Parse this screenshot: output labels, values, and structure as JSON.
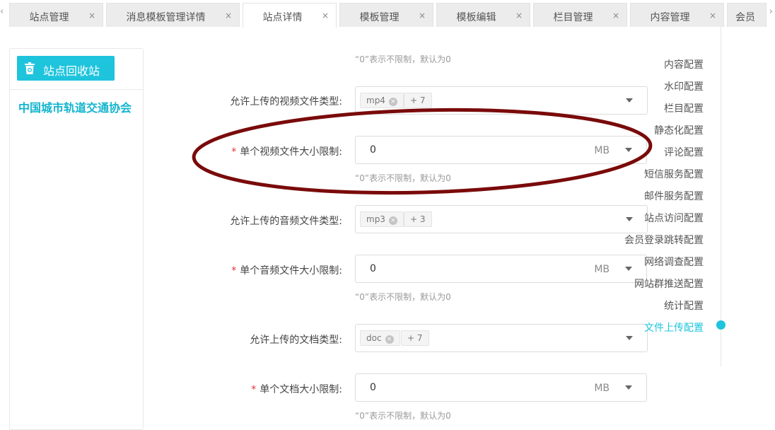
{
  "tabs": [
    {
      "label": "站点管理",
      "close": "×"
    },
    {
      "label": "消息模板管理详情",
      "close": "×"
    },
    {
      "label": "站点详情",
      "close": "×",
      "active": true
    },
    {
      "label": "模板管理",
      "close": "×"
    },
    {
      "label": "模板编辑",
      "close": "×"
    },
    {
      "label": "栏目管理",
      "close": "×"
    },
    {
      "label": "内容管理",
      "close": "×"
    },
    {
      "label": "会员",
      "close": ""
    }
  ],
  "tab_nav": {
    "prev": "‹",
    "next": "›"
  },
  "left_panel": {
    "recycle_button": "站点回收站",
    "recycle_icon": "trash-icon",
    "site_name": "中国城市轨道交通协会"
  },
  "form": {
    "top_hint": "“0”表示不限制，默认为0",
    "video_types": {
      "label": "允许上传的视频文件类型:",
      "chip": "mp4",
      "more": "+ 7"
    },
    "video_size": {
      "label": "单个视频文件大小限制:",
      "value": "0",
      "unit": "MB",
      "hint": "“0”表示不限制，默认为0"
    },
    "audio_types": {
      "label": "允许上传的音频文件类型:",
      "chip": "mp3",
      "more": "+ 3"
    },
    "audio_size": {
      "label": "单个音频文件大小限制:",
      "value": "0",
      "unit": "MB",
      "hint": "“0”表示不限制，默认为0"
    },
    "doc_types": {
      "label": "允许上传的文档类型:",
      "chip": "doc",
      "more": "+ 7"
    },
    "doc_size": {
      "label": "单个文档大小限制:",
      "value": "0",
      "unit": "MB",
      "hint": "“0”表示不限制，默认为0"
    },
    "required_mark": "*"
  },
  "anchor_nav": {
    "items": [
      "内容配置",
      "水印配置",
      "栏目配置",
      "静态化配置",
      "评论配置",
      "短信服务配置",
      "邮件服务配置",
      "站点访问配置",
      "会员登录跳转配置",
      "网络调查配置",
      "网站群推送配置",
      "统计配置",
      "文件上传配置"
    ],
    "active_index": 12
  },
  "colors": {
    "accent": "#1ec4dc",
    "annotation": "#7a0a0a",
    "required": "#e3303a"
  }
}
